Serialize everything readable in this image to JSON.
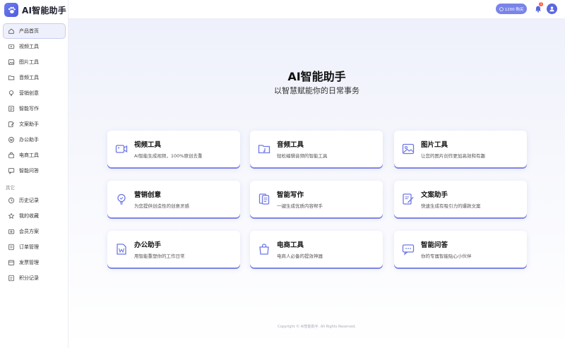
{
  "app": {
    "title": "AI智能助手"
  },
  "header": {
    "points_label": "1200 购买",
    "badge_count": "1"
  },
  "sidebar": {
    "items": [
      {
        "label": "产品首页",
        "icon": "home-icon",
        "active": true
      },
      {
        "label": "视频工具",
        "icon": "video-icon"
      },
      {
        "label": "图片工具",
        "icon": "image-icon"
      },
      {
        "label": "音频工具",
        "icon": "folder-icon"
      },
      {
        "label": "营销创意",
        "icon": "bulb-icon"
      },
      {
        "label": "智能写作",
        "icon": "doc-icon"
      },
      {
        "label": "文案助手",
        "icon": "edit-icon"
      },
      {
        "label": "办公助手",
        "icon": "office-icon"
      },
      {
        "label": "电商工具",
        "icon": "bag-icon"
      },
      {
        "label": "智能问答",
        "icon": "chat-icon"
      }
    ],
    "section_other": "其它",
    "other_items": [
      {
        "label": "历史记录",
        "icon": "history-icon"
      },
      {
        "label": "我的收藏",
        "icon": "star-icon"
      },
      {
        "label": "会员方案",
        "icon": "member-icon"
      },
      {
        "label": "订单管理",
        "icon": "order-icon"
      },
      {
        "label": "发票管理",
        "icon": "invoice-icon"
      },
      {
        "label": "积分记录",
        "icon": "points-icon"
      }
    ]
  },
  "hero": {
    "title": "AI智能助手",
    "subtitle": "以智慧赋能你的日常事务"
  },
  "cards": [
    {
      "title": "视频工具",
      "desc": "AI智能生成视频，100%原创去重",
      "icon": "video-icon"
    },
    {
      "title": "音频工具",
      "desc": "轻松编辑音频的智能工具",
      "icon": "folder-icon"
    },
    {
      "title": "图片工具",
      "desc": "让您的图片创作更加高效和有趣",
      "icon": "image-icon"
    },
    {
      "title": "营销创意",
      "desc": "为您提供创造性的创意灵感",
      "icon": "bulb-icon"
    },
    {
      "title": "智能写作",
      "desc": "一键生成优质内容帮手",
      "icon": "doc-icon"
    },
    {
      "title": "文案助手",
      "desc": "快速生成有吸引力的爆款文案",
      "icon": "edit-icon"
    },
    {
      "title": "办公助手",
      "desc": "用智能重塑你的工作日常",
      "icon": "office-icon"
    },
    {
      "title": "电商工具",
      "desc": "电商人必备的提效神器",
      "icon": "bag-icon"
    },
    {
      "title": "智能问答",
      "desc": "你的专属智能贴心小伙伴",
      "icon": "chat-icon"
    }
  ],
  "footer": {
    "text": "Copyright © AI智能助手. All Rights Reserved."
  },
  "colors": {
    "accent": "#5a66e0",
    "badge": "#ff5a3c",
    "card_shadow": "#7e86e6"
  }
}
